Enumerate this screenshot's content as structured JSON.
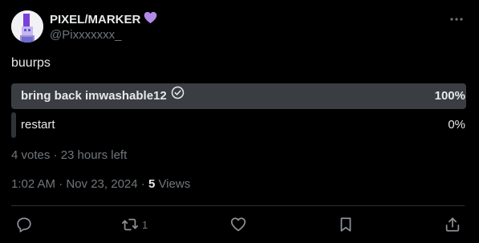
{
  "author": {
    "display_name": "PIXEL/MARKER",
    "handle": "@Pixxxxxxx_",
    "heart_emoji": "💜"
  },
  "tweet": {
    "text": "buurps"
  },
  "poll": {
    "options": [
      {
        "label": "bring back imwashable12",
        "percent_text": "100%",
        "percent": 100,
        "selected": true
      },
      {
        "label": "restart",
        "percent_text": "0%",
        "percent": 0,
        "selected": false
      }
    ],
    "meta": "4 votes · 23 hours left"
  },
  "timestamp": {
    "text": "1:02 AM · Nov 23, 2024 · ",
    "views_count": "5",
    "views_label": " Views"
  },
  "actions": {
    "reply_count": "",
    "retweet_count": "1",
    "like_count": "",
    "bookmark_count": ""
  },
  "colors": {
    "background": "#000000",
    "primary_text": "#e7e9ea",
    "secondary_text": "#71767b",
    "poll_bar_winner": "#3a3d42",
    "poll_bar": "#2f3336",
    "divider": "#2f3336",
    "heart_emoji": "#b18ae8"
  },
  "icons": {
    "more": "more-horizontal-icon",
    "check": "check-circle-icon",
    "reply": "reply-icon",
    "retweet": "retweet-icon",
    "like": "heart-outline-icon",
    "bookmark": "bookmark-icon",
    "share": "share-icon"
  }
}
